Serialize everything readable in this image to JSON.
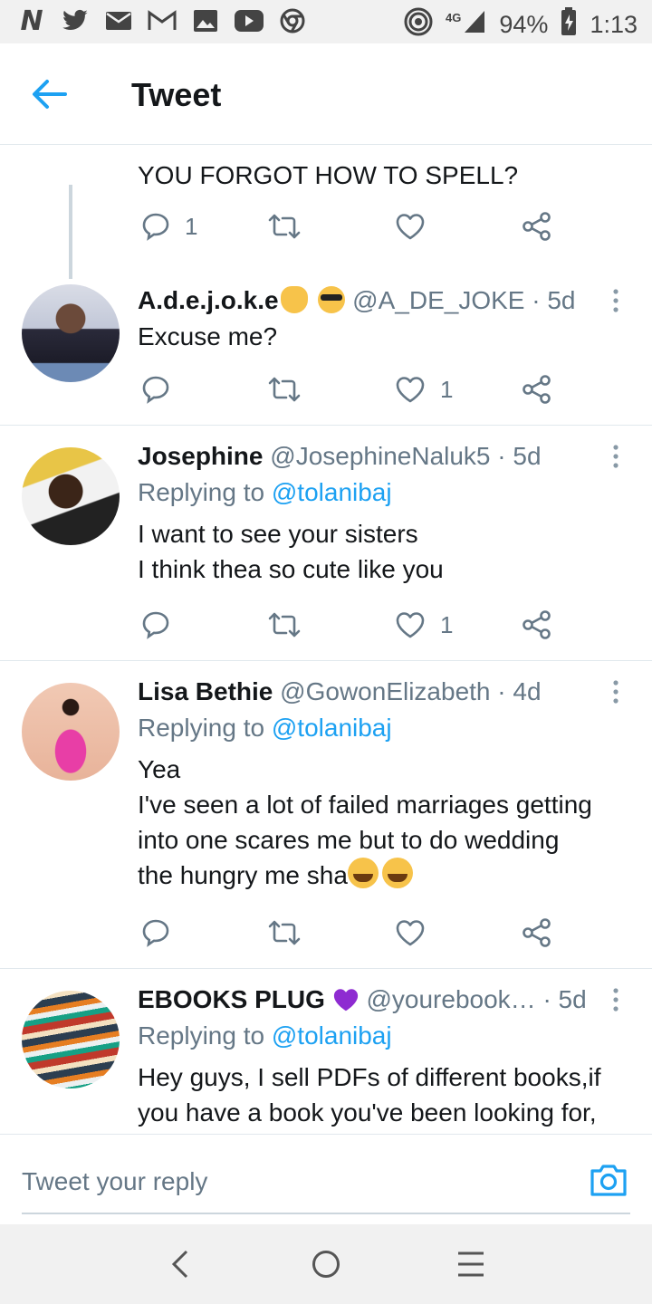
{
  "status_bar": {
    "left_icons": [
      "n-icon",
      "twitter-icon",
      "mail-icon",
      "gmail-icon",
      "gallery-icon",
      "youtube-icon",
      "chrome-icon"
    ],
    "network": "4G",
    "battery": "94%",
    "time": "1:13"
  },
  "header": {
    "title": "Tweet"
  },
  "tweets": [
    {
      "text": "YOU FORGOT HOW TO SPELL?",
      "reply_count": "1",
      "retweet_count": "",
      "like_count": ""
    },
    {
      "name": "A.d.e.j.o.k.e",
      "emojis": [
        "ok-hand-emoji",
        "sunglasses-emoji"
      ],
      "handle": "@A_DE_JOKE",
      "time": "· 5d",
      "text": "Excuse me?",
      "reply_count": "",
      "retweet_count": "",
      "like_count": "1"
    },
    {
      "name": "Josephine",
      "handle": "@JosephineNaluk5",
      "time": "· 5d",
      "replying_prefix": "Replying to ",
      "replying_to": "@tolanibaj",
      "text_lines": [
        "I want to see your sisters",
        "I think thea so cute like you"
      ],
      "reply_count": "",
      "retweet_count": "",
      "like_count": "1"
    },
    {
      "name": "Lisa Bethie",
      "handle": "@GowonElizabeth",
      "time": "· 4d",
      "replying_prefix": "Replying to ",
      "replying_to": "@tolanibaj",
      "text_lines": [
        "Yea",
        "I've seen a lot of failed marriages getting",
        "into one scares me but to do wedding",
        "the hungry me sha"
      ],
      "emojis": [
        "grinning-emoji",
        "grinning-emoji"
      ],
      "reply_count": "",
      "retweet_count": "",
      "like_count": ""
    },
    {
      "name": "EBOOKS PLUG",
      "emojis": [
        "purple-heart-emoji"
      ],
      "handle": "@yourebook…",
      "time": "· 5d",
      "replying_prefix": "Replying to ",
      "replying_to": "@tolanibaj",
      "text_lines": [
        "Hey guys, I sell PDFs of different books,if",
        "you have a book you've been looking for,"
      ]
    }
  ],
  "reply_bar": {
    "placeholder": "Tweet your reply"
  },
  "colors": {
    "accent": "#1da1f2",
    "secondary_text": "#657786",
    "divider": "#e1e8ed"
  }
}
